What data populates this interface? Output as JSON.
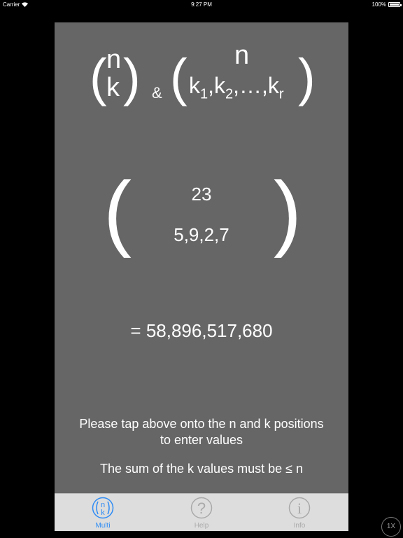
{
  "status_bar": {
    "carrier": "Carrier",
    "time": "9:27 PM",
    "battery": "100%"
  },
  "formula": {
    "binomial_top": "n",
    "binomial_bottom": "k",
    "ampersand": "&",
    "multi_top": "n",
    "multi_bottom_k": "k",
    "multi_bottom_1": "1",
    "multi_bottom_2": "2",
    "multi_bottom_r": "r",
    "multi_comma": ",",
    "multi_ellipsis": ",…,"
  },
  "input": {
    "n_value": "23",
    "k_values": "5,9,2,7"
  },
  "result": {
    "text": "= 58,896,517,680"
  },
  "instructions": {
    "line1": "Please tap above onto the n and k positions to enter values",
    "line2": "The sum of the k values must be ≤ n"
  },
  "tabs": [
    {
      "label": "Multi",
      "active": true
    },
    {
      "label": "Help",
      "active": false
    },
    {
      "label": "Info",
      "active": false
    }
  ],
  "scale_button": "1X",
  "colors": {
    "panel": "#666666",
    "tab_active": "#2f8cf4",
    "tab_inactive": "#a9a9a9"
  }
}
